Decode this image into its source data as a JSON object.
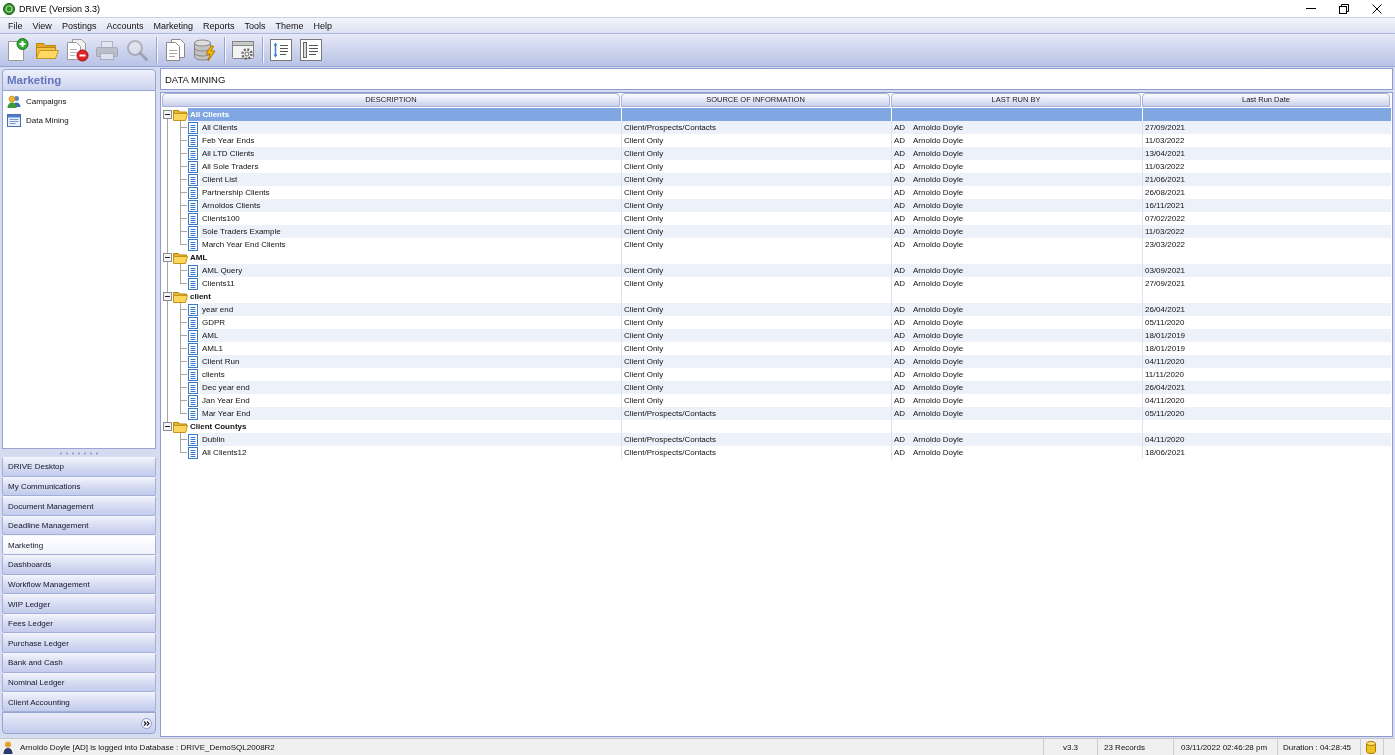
{
  "window": {
    "title": "DRIVE (Version 3.3)"
  },
  "menu": [
    "File",
    "View",
    "Postings",
    "Accounts",
    "Marketing",
    "Reports",
    "Tools",
    "Theme",
    "Help"
  ],
  "toolbar": [
    [
      {
        "kind": "new",
        "disabled": false
      },
      {
        "kind": "open",
        "disabled": false
      },
      {
        "kind": "delete",
        "disabled": false
      },
      {
        "kind": "print",
        "disabled": true
      },
      {
        "kind": "search",
        "disabled": true
      }
    ],
    [
      {
        "kind": "pages",
        "disabled": false
      },
      {
        "kind": "database",
        "disabled": false
      }
    ],
    [
      {
        "kind": "settings",
        "disabled": false
      }
    ],
    [
      {
        "kind": "sort",
        "disabled": false
      },
      {
        "kind": "list",
        "disabled": false
      }
    ]
  ],
  "sidebar": {
    "title": "Marketing",
    "items": [
      {
        "kind": "campaigns",
        "label": "Campaigns"
      },
      {
        "kind": "mining",
        "label": "Data Mining"
      }
    ]
  },
  "navigation": [
    {
      "label": "DRIVE Desktop",
      "selected": false
    },
    {
      "label": "My Communications",
      "selected": false
    },
    {
      "label": "Document Management",
      "selected": false
    },
    {
      "label": "Deadline Management",
      "selected": false
    },
    {
      "label": "Marketing",
      "selected": true
    },
    {
      "label": "Dashboards",
      "selected": false
    },
    {
      "label": "Workflow Management",
      "selected": false
    },
    {
      "label": "WIP Ledger",
      "selected": false
    },
    {
      "label": "Fees Ledger",
      "selected": false
    },
    {
      "label": "Purchase Ledger",
      "selected": false
    },
    {
      "label": "Bank and Cash",
      "selected": false
    },
    {
      "label": "Nominal Ledger",
      "selected": false
    },
    {
      "label": "Client Accounting",
      "selected": false
    }
  ],
  "panel_title": "DATA MINING",
  "table": {
    "columns": [
      "DESCRIPTION",
      "SOURCE OF INFORMATION",
      "LAST RUN BY",
      "Last Run Date"
    ],
    "groups": [
      {
        "name": "All Clients",
        "expanded": true,
        "selected": true,
        "rows": [
          {
            "description": "All Clients",
            "source": "Client/Prospects/Contacts",
            "initials": "AD",
            "last_run_by": "Arnoldo Doyle",
            "last_run_date": "27/09/2021",
            "selected": false
          },
          {
            "description": "Feb Year Ends",
            "source": "Client Only",
            "initials": "AD",
            "last_run_by": "Arnoldo Doyle",
            "last_run_date": "11/03/2022",
            "selected": false
          },
          {
            "description": "All LTD Clients",
            "source": "Client Only",
            "initials": "AD",
            "last_run_by": "Arnoldo Doyle",
            "last_run_date": "13/04/2021",
            "selected": false
          },
          {
            "description": "All Sole Traders",
            "source": "Client Only",
            "initials": "AD",
            "last_run_by": "Arnoldo Doyle",
            "last_run_date": "11/03/2022",
            "selected": false
          },
          {
            "description": "Client List",
            "source": "Client Only",
            "initials": "AD",
            "last_run_by": "Arnoldo Doyle",
            "last_run_date": "21/06/2021",
            "selected": false
          },
          {
            "description": "Partnership Clients",
            "source": "Client Only",
            "initials": "AD",
            "last_run_by": "Arnoldo Doyle",
            "last_run_date": "26/08/2021",
            "selected": false
          },
          {
            "description": "Arnoldos Clients",
            "source": "Client Only",
            "initials": "AD",
            "last_run_by": "Arnoldo Doyle",
            "last_run_date": "16/11/2021",
            "selected": false
          },
          {
            "description": "Clients100",
            "source": "Client Only",
            "initials": "AD",
            "last_run_by": "Arnoldo Doyle",
            "last_run_date": "07/02/2022",
            "selected": false
          },
          {
            "description": "Sole Traders Example",
            "source": "Client Only",
            "initials": "AD",
            "last_run_by": "Arnoldo Doyle",
            "last_run_date": "11/03/2022",
            "selected": false
          },
          {
            "description": "March Year End Clients",
            "source": "Client Only",
            "initials": "AD",
            "last_run_by": "Arnoldo Doyle",
            "last_run_date": "23/03/2022",
            "selected": false
          }
        ]
      },
      {
        "name": "AML",
        "expanded": true,
        "selected": false,
        "rows": [
          {
            "description": "AML Query",
            "source": "Client Only",
            "initials": "AD",
            "last_run_by": "Arnoldo Doyle",
            "last_run_date": "03/09/2021",
            "selected": false
          },
          {
            "description": "Clients11",
            "source": "Client Only",
            "initials": "AD",
            "last_run_by": "Arnoldo Doyle",
            "last_run_date": "27/09/2021",
            "selected": false
          }
        ]
      },
      {
        "name": "client",
        "expanded": true,
        "selected": false,
        "rows": [
          {
            "description": "year end",
            "source": "Client Only",
            "initials": "AD",
            "last_run_by": "Arnoldo Doyle",
            "last_run_date": "26/04/2021",
            "selected": false
          },
          {
            "description": "GDPR",
            "source": "Client Only",
            "initials": "AD",
            "last_run_by": "Arnoldo Doyle",
            "last_run_date": "05/11/2020",
            "selected": false
          },
          {
            "description": "AML",
            "source": "Client Only",
            "initials": "AD",
            "last_run_by": "Arnoldo Doyle",
            "last_run_date": "18/01/2019",
            "selected": false
          },
          {
            "description": "AML1",
            "source": "Client Only",
            "initials": "AD",
            "last_run_by": "Arnoldo Doyle",
            "last_run_date": "18/01/2019",
            "selected": false
          },
          {
            "description": "Client Run",
            "source": "Client Only",
            "initials": "AD",
            "last_run_by": "Arnoldo Doyle",
            "last_run_date": "04/11/2020",
            "selected": false
          },
          {
            "description": "clients",
            "source": "Client Only",
            "initials": "AD",
            "last_run_by": "Arnoldo Doyle",
            "last_run_date": "11/11/2020",
            "selected": false
          },
          {
            "description": "Dec year end",
            "source": "Client Only",
            "initials": "AD",
            "last_run_by": "Arnoldo Doyle",
            "last_run_date": "26/04/2021",
            "selected": false
          },
          {
            "description": "Jan Year End",
            "source": "Client Only",
            "initials": "AD",
            "last_run_by": "Arnoldo Doyle",
            "last_run_date": "04/11/2020",
            "selected": false
          },
          {
            "description": "Mar Year End",
            "source": "Client/Prospects/Contacts",
            "initials": "AD",
            "last_run_by": "Arnoldo Doyle",
            "last_run_date": "05/11/2020",
            "selected": false
          }
        ]
      },
      {
        "name": "Client Countys",
        "expanded": true,
        "selected": false,
        "rows": [
          {
            "description": "Dublin",
            "source": "Client/Prospects/Contacts",
            "initials": "AD",
            "last_run_by": "Arnoldo Doyle",
            "last_run_date": "04/11/2020",
            "selected": false
          },
          {
            "description": "All Clients12",
            "source": "Client/Prospects/Contacts",
            "initials": "AD",
            "last_run_by": "Arnoldo Doyle",
            "last_run_date": "18/06/2021",
            "selected": false
          }
        ]
      }
    ]
  },
  "status_bar": {
    "message": "Arnoldo Doyle [AD] is logged into Database : DRIVE_DemoSQL2008R2",
    "version": "v3.3",
    "records": "23 Records",
    "timestamp": "03/11/2022 02:46:28 pm",
    "duration": "Duration : 04:28:45"
  }
}
